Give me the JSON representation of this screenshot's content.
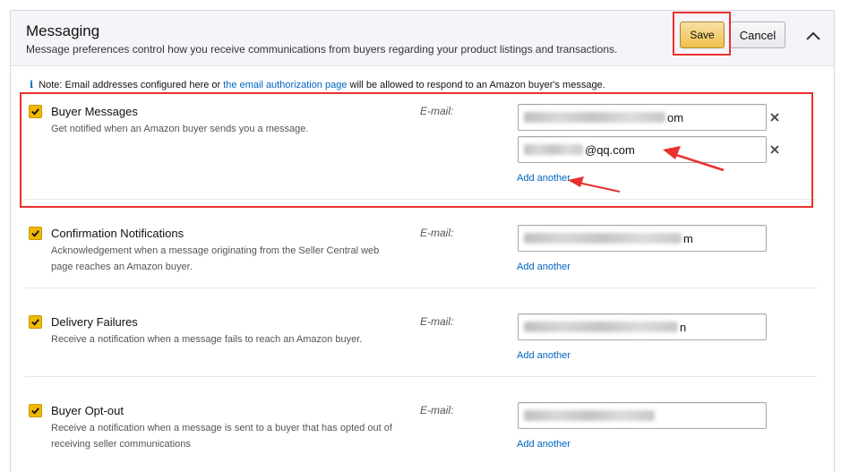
{
  "header": {
    "title": "Messaging",
    "description": "Message preferences control how you receive communications from buyers regarding your product listings and transactions.",
    "save_label": "Save",
    "cancel_label": "Cancel"
  },
  "note": {
    "prefix": "Note: Email addresses configured here or ",
    "link_text": "the email authorization page",
    "suffix": " will be allowed to respond to an Amazon buyer's message."
  },
  "email_label": "E-mail:",
  "add_another_label": "Add another",
  "rows": [
    {
      "title": "Buyer Messages",
      "description": "Get notified when an Amazon buyer sends you a message.",
      "checked": true,
      "emails": [
        {
          "visible_suffix": "om"
        },
        {
          "visible_suffix": "@qq.com"
        }
      ]
    },
    {
      "title": "Confirmation Notifications",
      "description": "Acknowledgement when a message originating from the Seller Central web page reaches an Amazon buyer.",
      "checked": true,
      "emails": [
        {
          "visible_suffix": "m"
        }
      ]
    },
    {
      "title": "Delivery Failures",
      "description": "Receive a notification when a message fails to reach an Amazon buyer.",
      "checked": true,
      "emails": [
        {
          "visible_suffix": "n"
        }
      ]
    },
    {
      "title": "Buyer Opt-out",
      "description": "Receive a notification when a message is sent to a buyer that has opted out of receiving seller communications",
      "checked": true,
      "emails": [
        {
          "visible_suffix": ""
        }
      ]
    }
  ],
  "colors": {
    "accent_yellow": "#f0c14b",
    "link_blue": "#0066c0",
    "annotation_red": "#e8312e"
  }
}
